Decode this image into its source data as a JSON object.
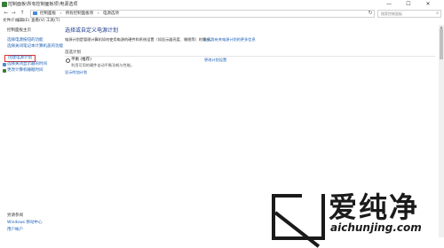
{
  "window": {
    "title": "控制面板\\所有控制面板项\\电源选项",
    "minimize": "—",
    "maximize": "☐",
    "close": "✕"
  },
  "nav": {
    "back": "←",
    "forward": "→",
    "up": "↑",
    "breadcrumbs": [
      "控制面板",
      "所有控制面板项",
      "电源选项"
    ],
    "refresh": "↻",
    "search_placeholder": "搜索控制面板"
  },
  "menu": {
    "items": [
      "文件(F)",
      "编辑(E)",
      "查看(V)",
      "工具(T)"
    ]
  },
  "sidebar": {
    "home": "控制面板主页",
    "items": [
      "选择电源按钮的功能",
      "选择关闭笔记本计算机盖的功能",
      "创建电源计划",
      "选择关闭显示器的时间",
      "更改计算机睡眠时间"
    ],
    "see_also_title": "另请参阅",
    "see_also": [
      "Windows 移动中心",
      "用户帐户"
    ]
  },
  "main": {
    "title": "选择或自定义电源计划",
    "description": "电源计划是管理计算机如何使用电源的硬件和系统设置（如显示器亮度、睡眠等）的集合。",
    "description_link": "告诉我有关电源计划的更多信息",
    "section": "首选计划",
    "plan_name": "平衡 (推荐)",
    "plan_description": "利用可用的硬件自动平衡功耗与性能。",
    "plan_link": "更改计划设置",
    "show_more": "显示附加计划"
  },
  "watermark": {
    "text": "爱纯净",
    "url": "aichunjing.com"
  },
  "colors": {
    "link": "#1a5fb4",
    "title": "#1e3a8a",
    "highlight": "#e03030"
  }
}
